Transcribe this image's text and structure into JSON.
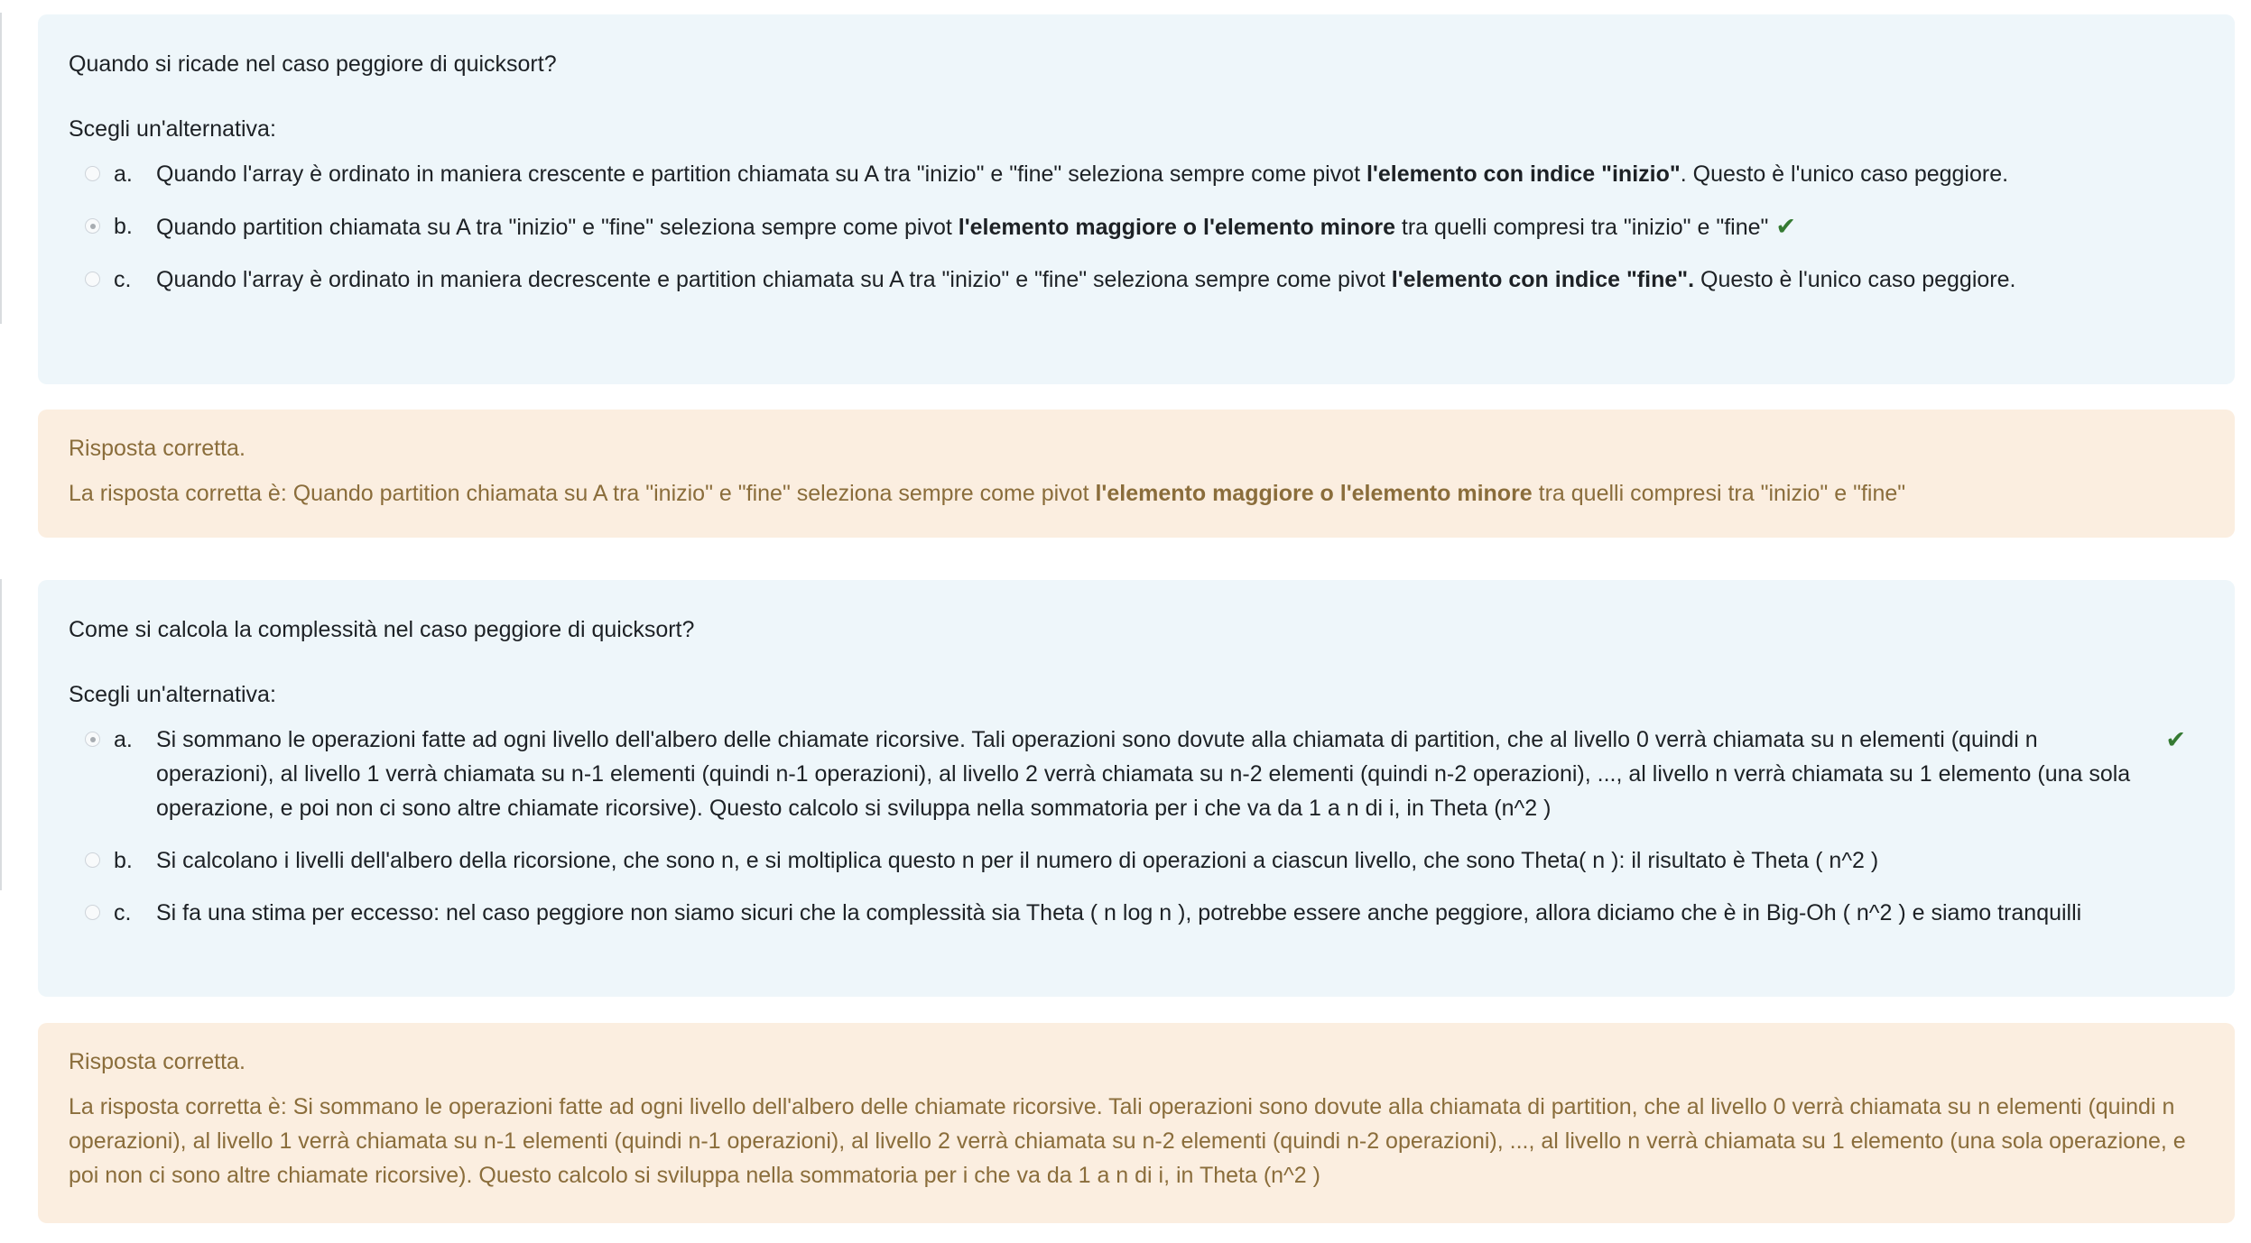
{
  "questions": [
    {
      "text": "Quando si ricade nel caso peggiore di quicksort?",
      "prompt": "Scegli un'alternativa:",
      "answers": [
        {
          "letter": "a.",
          "selected": false,
          "correct_mark": false,
          "pre": "Quando l'array è ordinato in maniera crescente e partition chiamata su A tra \"inizio\" e \"fine\" seleziona sempre come pivot ",
          "bold": "l'elemento con indice \"inizio\"",
          "post": ". Questo è l'unico caso peggiore."
        },
        {
          "letter": "b.",
          "selected": true,
          "correct_mark": true,
          "pre": "Quando partition chiamata su A tra \"inizio\" e \"fine\" seleziona sempre come pivot ",
          "bold": "l'elemento maggiore o l'elemento minore",
          "post": " tra quelli compresi tra \"inizio\" e \"fine\""
        },
        {
          "letter": "c.",
          "selected": false,
          "correct_mark": false,
          "pre": "Quando l'array è ordinato in maniera decrescente e partition chiamata su A tra \"inizio\" e \"fine\" seleziona sempre come pivot ",
          "bold": "l'elemento con indice \"fine\".",
          "post": " Questo è l'unico caso peggiore."
        }
      ],
      "feedback": {
        "status": "Risposta corretta.",
        "pre": "La risposta corretta è: Quando partition chiamata su A tra \"inizio\" e \"fine\" seleziona sempre come pivot ",
        "bold": "l'elemento maggiore o l'elemento minore",
        "post": " tra quelli compresi tra \"inizio\" e \"fine\""
      }
    },
    {
      "text": "Come si calcola la complessità nel caso peggiore di quicksort?",
      "prompt": "Scegli un'alternativa:",
      "answers": [
        {
          "letter": "a.",
          "selected": true,
          "correct_mark": true,
          "text": "Si sommano le operazioni fatte ad ogni livello dell'albero delle chiamate ricorsive. Tali operazioni sono dovute alla chiamata di partition, che al livello 0 verrà chiamata su n elementi (quindi n operazioni), al livello 1 verrà chiamata su n-1 elementi (quindi n-1 operazioni), al livello 2 verrà chiamata su n-2 elementi (quindi n-2 operazioni), ..., al livello n verrà chiamata su 1 elemento (una sola operazione, e poi non ci sono altre chiamate ricorsive). Questo calcolo si sviluppa nella sommatoria per i che va da 1 a n di i, in Theta (n^2 )"
        },
        {
          "letter": "b.",
          "selected": false,
          "correct_mark": false,
          "text": "Si calcolano i livelli dell'albero della ricorsione, che sono n, e si moltiplica questo n per il numero di operazioni a ciascun livello, che sono Theta( n ): il risultato è Theta ( n^2 )"
        },
        {
          "letter": "c.",
          "selected": false,
          "correct_mark": false,
          "text": "Si fa una stima per eccesso: nel caso peggiore non siamo sicuri che la complessità sia Theta ( n log n ), potrebbe essere anche peggiore, allora diciamo che è in Big-Oh ( n^2 ) e siamo tranquilli"
        }
      ],
      "feedback": {
        "status": "Risposta corretta.",
        "text": "La risposta corretta è: Si sommano le operazioni fatte ad ogni livello dell'albero delle chiamate ricorsive. Tali operazioni sono dovute alla chiamata di partition, che al livello 0 verrà chiamata su n elementi (quindi n operazioni), al livello 1 verrà chiamata su n-1 elementi (quindi n-1 operazioni), al livello 2 verrà chiamata su n-2 elementi (quindi n-2 operazioni), ..., al livello n verrà chiamata su 1 elemento (una sola operazione, e poi non ci sono altre chiamate ricorsive). Questo calcolo si sviluppa nella sommatoria per i che va da 1 a n di i, in Theta (n^2 )"
      }
    }
  ],
  "colors": {
    "question_bg": "#eef6fa",
    "feedback_bg": "#fbeee0",
    "feedback_text": "#8a6d3b",
    "check": "#357a32"
  },
  "icons": {
    "check": "check-icon",
    "radio": "radio-icon"
  }
}
